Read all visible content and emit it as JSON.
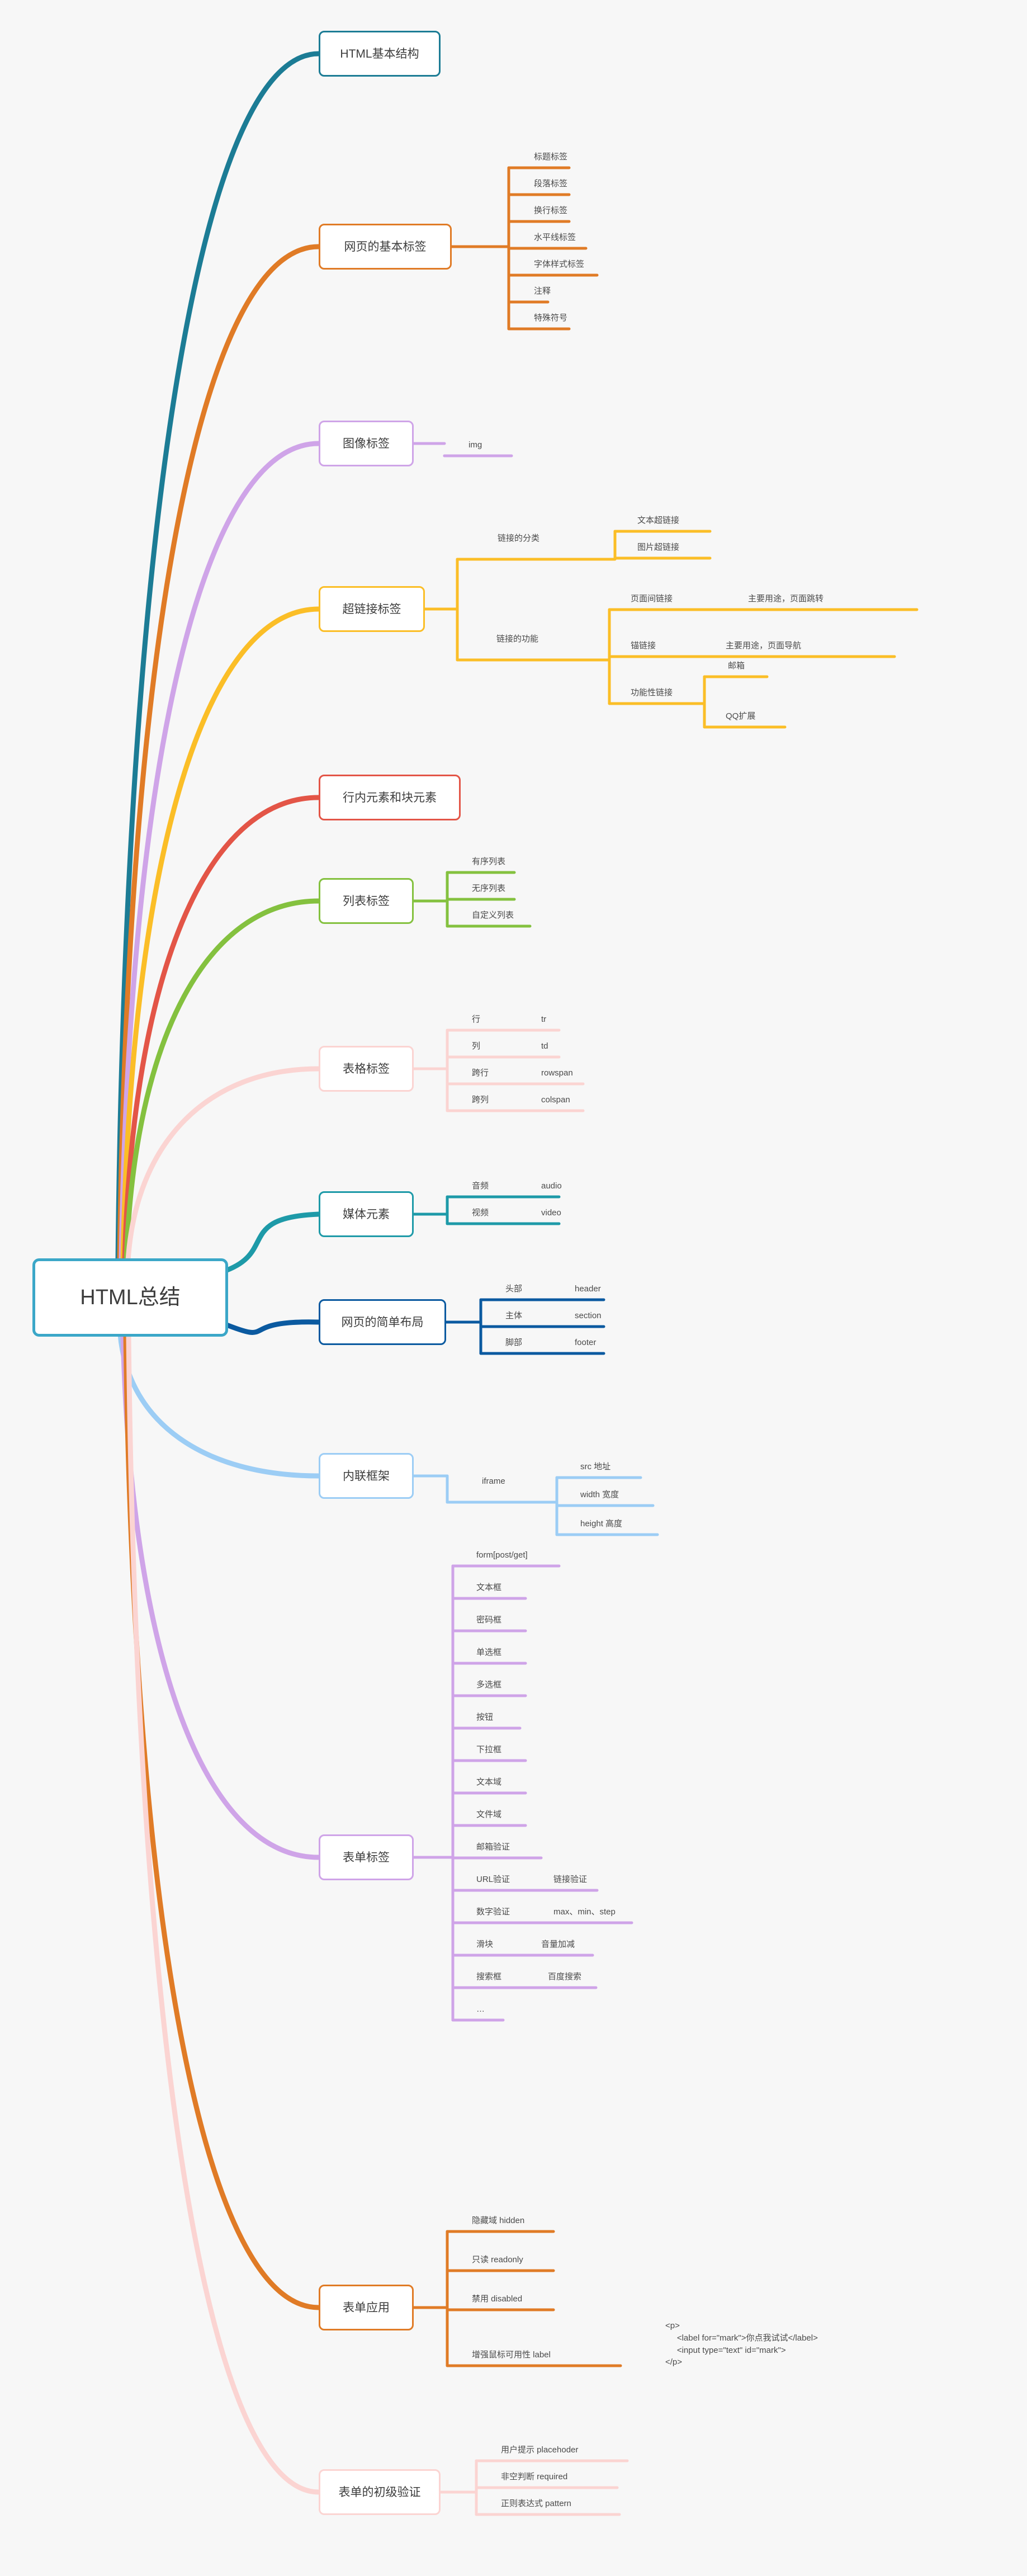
{
  "root": {
    "label": "HTML总结",
    "color": "#3ba7c8"
  },
  "branches": [
    {
      "label": "HTML基本结构",
      "color": "#1c7c95",
      "children": []
    },
    {
      "label": "网页的基本标签",
      "color": "#e07b26",
      "children": [
        {
          "label": "标题标签"
        },
        {
          "label": "段落标签"
        },
        {
          "label": "换行标签"
        },
        {
          "label": "水平线标签"
        },
        {
          "label": "字体样式标签"
        },
        {
          "label": "注释"
        },
        {
          "label": "特殊符号"
        }
      ]
    },
    {
      "label": "图像标签",
      "color": "#cfa4e8",
      "children": [
        {
          "label": "img"
        }
      ]
    },
    {
      "label": "超链接标签",
      "color": "#fbbe27",
      "children": [
        {
          "label": "链接的分类",
          "children": [
            {
              "label": "文本超链接"
            },
            {
              "label": "图片超链接"
            }
          ]
        },
        {
          "label": "链接的功能",
          "children": [
            {
              "label": "页面间链接",
              "note": "主要用途，页面跳转"
            },
            {
              "label": "锚链接",
              "note": "主要用途，页面导航"
            },
            {
              "label": "功能性链接",
              "children": [
                {
                  "label": "邮箱"
                },
                {
                  "label": "QQ扩展"
                }
              ]
            }
          ]
        }
      ]
    },
    {
      "label": "行内元素和块元素",
      "color": "#e35547",
      "children": []
    },
    {
      "label": "列表标签",
      "color": "#84c13f",
      "children": [
        {
          "label": "有序列表"
        },
        {
          "label": "无序列表"
        },
        {
          "label": "自定义列表"
        }
      ]
    },
    {
      "label": "表格标签",
      "color": "#fbd4d2",
      "children": [
        {
          "label": "行",
          "note": "tr"
        },
        {
          "label": "列",
          "note": "td"
        },
        {
          "label": "跨行",
          "note": "rowspan"
        },
        {
          "label": "跨列",
          "note": "colspan"
        }
      ]
    },
    {
      "label": "媒体元素",
      "color": "#1e9aa8",
      "children": [
        {
          "label": "音频",
          "note": "audio"
        },
        {
          "label": "视频",
          "note": "video"
        }
      ]
    },
    {
      "label": "网页的简单布局",
      "color": "#0b5aa0",
      "children": [
        {
          "label": "头部",
          "note": "header"
        },
        {
          "label": "主体",
          "note": "section"
        },
        {
          "label": "脚部",
          "note": "footer"
        }
      ]
    },
    {
      "label": "内联框架",
      "color": "#9ccdf5",
      "children": [
        {
          "label": "iframe",
          "children": [
            {
              "label": "src 地址"
            },
            {
              "label": "width 宽度"
            },
            {
              "label": "height 高度"
            }
          ]
        }
      ]
    },
    {
      "label": "表单标签",
      "color": "#cfa4e8",
      "children": [
        {
          "label": "form[post/get]"
        },
        {
          "label": "文本框"
        },
        {
          "label": "密码框"
        },
        {
          "label": "单选框"
        },
        {
          "label": "多选框"
        },
        {
          "label": "按钮"
        },
        {
          "label": "下拉框"
        },
        {
          "label": "文本域"
        },
        {
          "label": "文件域"
        },
        {
          "label": "邮箱验证"
        },
        {
          "label": "URL验证",
          "note": "链接验证"
        },
        {
          "label": "数字验证",
          "note": "max、min、step"
        },
        {
          "label": "滑块",
          "note": "音量加减"
        },
        {
          "label": "搜索框",
          "note": "百度搜索"
        },
        {
          "label": "…"
        }
      ]
    },
    {
      "label": "表单应用",
      "color": "#e07b26",
      "children": [
        {
          "label": "隐藏域 hidden"
        },
        {
          "label": "只读 readonly"
        },
        {
          "label": "禁用 disabled"
        },
        {
          "label": "增强鼠标可用性 label",
          "code": "<p>\n     <label for=\"mark\">你点我试试</label>\n     <input type=\"text\" id=\"mark\">\n</p>"
        }
      ]
    },
    {
      "label": "表单的初级验证",
      "color": "#fbd4d2",
      "children": [
        {
          "label": "用户提示 placehoder"
        },
        {
          "label": "非空判断 required"
        },
        {
          "label": "正则表达式 pattern"
        }
      ]
    }
  ]
}
